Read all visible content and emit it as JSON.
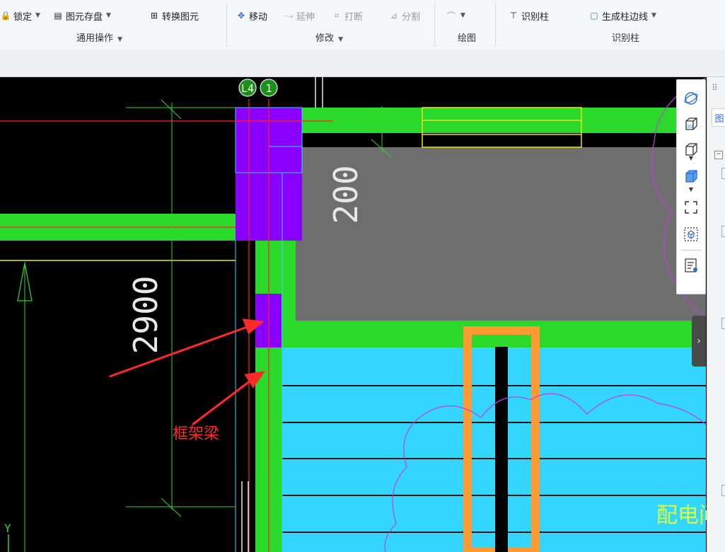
{
  "ribbon": {
    "general": {
      "lock": "锁定",
      "save_element": "图元存盘",
      "convert_element": "转换图元",
      "group_label": "通用操作"
    },
    "modify": {
      "move": "移动",
      "extend": "延伸",
      "break": "打断",
      "split": "分割",
      "group_label": "修改"
    },
    "draw": {
      "group_label": "绘图"
    },
    "identify": {
      "identify_column": "识别柱",
      "generate_column_edge": "生成柱边线",
      "group_label": "识别柱"
    }
  },
  "canvas": {
    "axis_label_left": "L4",
    "axis_label_right": "1",
    "dim_200": "200",
    "dim_2900": "2900",
    "annotation": "框架梁",
    "room_label": "配电间",
    "y_axis": "Y"
  },
  "right_panel": {
    "tab_label": "图"
  },
  "colors": {
    "beam_green": "#2bd92b",
    "column_purple": "#8a00ff",
    "slab_gray": "#6e6e6e",
    "room_cyan": "#33d6ff",
    "opening_orange": "#ff9a30",
    "annotation_red": "#ff2a2a",
    "cloud_magenta": "#c040e0"
  },
  "icons": {
    "view_toolbar": [
      "orbit-icon",
      "3d-view-icon",
      "cube-icon",
      "shaded-cube-icon",
      "zoom-extents-icon",
      "select-box-icon",
      "layer-list-icon"
    ]
  }
}
